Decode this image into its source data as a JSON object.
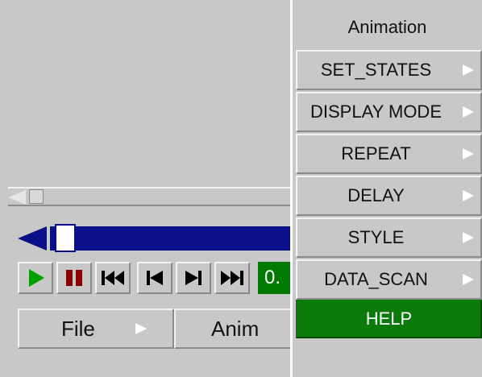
{
  "colors": {
    "panel_bg": "#c8c8c8",
    "timeline_blue": "#0a0f8a",
    "help_green": "#0a7a0a",
    "play_green": "#00a000",
    "stop_red": "#8a0000"
  },
  "left": {
    "frame_readout": "0.",
    "tabs": [
      {
        "label": "File"
      },
      {
        "label": "Anim"
      }
    ],
    "controls": [
      {
        "name": "play",
        "icon": "play-icon"
      },
      {
        "name": "stop",
        "icon": "stop-icon"
      },
      {
        "name": "first",
        "icon": "skip-to-start-icon"
      },
      {
        "name": "prev",
        "icon": "step-back-icon"
      },
      {
        "name": "next",
        "icon": "step-forward-icon"
      },
      {
        "name": "last",
        "icon": "skip-to-end-icon"
      }
    ]
  },
  "menu": {
    "title": "Animation",
    "items": [
      {
        "label": "SET_STATES"
      },
      {
        "label": "DISPLAY MODE"
      },
      {
        "label": "REPEAT"
      },
      {
        "label": "DELAY"
      },
      {
        "label": "STYLE"
      },
      {
        "label": "DATA_SCAN"
      },
      {
        "label": "HELP"
      }
    ]
  }
}
